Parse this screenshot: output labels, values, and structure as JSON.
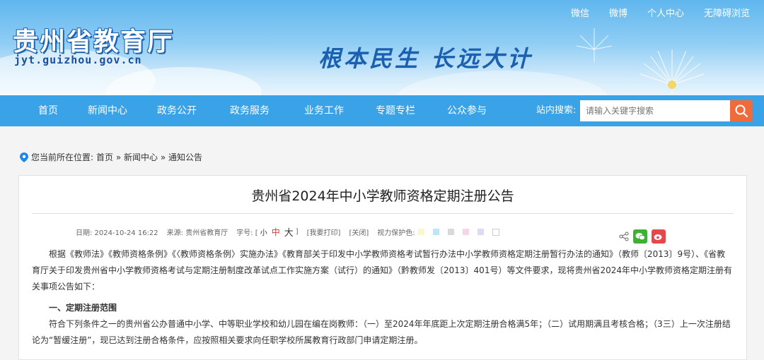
{
  "header": {
    "site_title": "贵州省教育厅",
    "domain": "jyt.guizhou.gov.cn",
    "slogan": "根本民生 长远大计",
    "top_links": [
      "微信",
      "微博",
      "个人中心",
      "无障碍浏览"
    ]
  },
  "nav": {
    "items": [
      "首页",
      "新闻中心",
      "政务公开",
      "政务服务",
      "业务工作",
      "专题专栏",
      "公众参与"
    ],
    "search_label": "站内搜索:",
    "search_placeholder": "请输入关键字搜索"
  },
  "breadcrumb": {
    "prefix": "您当前所在位置:",
    "path": "首页 » 新闻中心 » 通知公告"
  },
  "article": {
    "title": "贵州省2024年中小学教师资格定期注册公告",
    "date": "日期: 2024-10-24 16:22",
    "source": "来源: 贵州省教育厅",
    "font_label": "字号: [",
    "font_small": "小",
    "font_medium": "中",
    "font_large": "大",
    "font_close": "]",
    "print": "[我要打印]",
    "close": "[关闭]",
    "eye_label": "视力保护色:",
    "eye_colors": [
      "#fbf7c6",
      "#bfe6f7",
      "#d9d9d9",
      "#f5d6e4",
      "#e0d9f5",
      "#ffffff"
    ],
    "para1": "根据《教师法》《教师资格条例》《〈教师资格条例〉实施办法》《教育部关于印发中小学教师资格考试暂行办法中小学教师资格定期注册暂行办法的通知》（教师〔2013〕9号）、《省教育厅关于印发贵州省中小学教师资格考试与定期注册制度改革试点工作实施方案（试行）的通知》（黔教师发〔2013〕401号）等文件要求，现将贵州省2024年中小学教师资格定期注册有关事项公告如下：",
    "section1": "一、定期注册范围",
    "para2": "符合下列条件之一的贵州省公办普通中小学、中等职业学校和幼儿园在编在岗教师：（一）至2024年年底距上次定期注册合格满5年；（二）试用期满且考核合格；（3三）上一次注册结论为“暂缓注册”，现已达到注册合格条件，应按照相关要求向任职学校所属教育行政部门申请定期注册。"
  }
}
